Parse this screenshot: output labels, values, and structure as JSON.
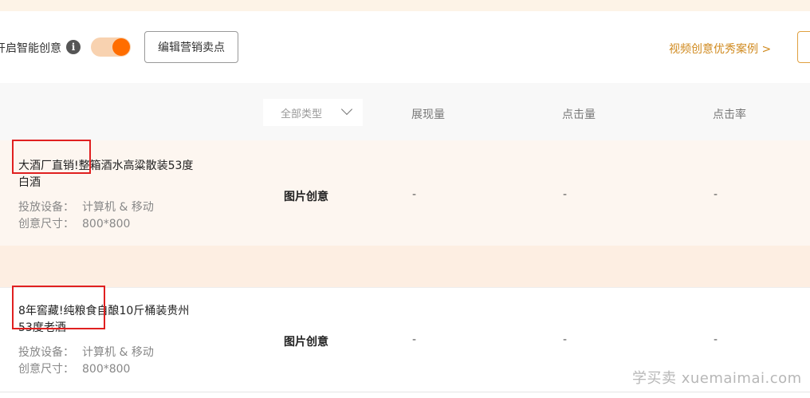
{
  "toolbar": {
    "smart_label": "开启智能创意",
    "edit_button": "编辑营销卖点",
    "cases_link": "视频创意优秀案例 >"
  },
  "table": {
    "type_filter": "全部类型",
    "columns": [
      "展现量",
      "点击量",
      "点击率"
    ]
  },
  "rows": [
    {
      "title_line1": "大酒厂直销!整箱酒水高粱散装53度",
      "title_line2": "白酒",
      "device_label": "投放设备：",
      "device_value": "计算机 & 移动",
      "size_label": "创意尺寸：",
      "size_value": "800*800",
      "creative_type": "图片创意",
      "impressions": "-",
      "clicks": "-",
      "ctr": "-"
    },
    {
      "title_line1": "8年窖藏!纯粮食自酿10斤桶装贵州",
      "title_line2": "53度老酒",
      "device_label": "投放设备：",
      "device_value": "计算机 & 移动",
      "size_label": "创意尺寸：",
      "size_value": "800*800",
      "creative_type": "图片创意",
      "impressions": "-",
      "clicks": "-",
      "ctr": "-"
    }
  ],
  "watermark": "学买卖 xuemaimai.com",
  "colors": {
    "accent_orange": "#ff6d00",
    "link_gold": "#d08a1f",
    "highlight_red": "#e02020"
  }
}
